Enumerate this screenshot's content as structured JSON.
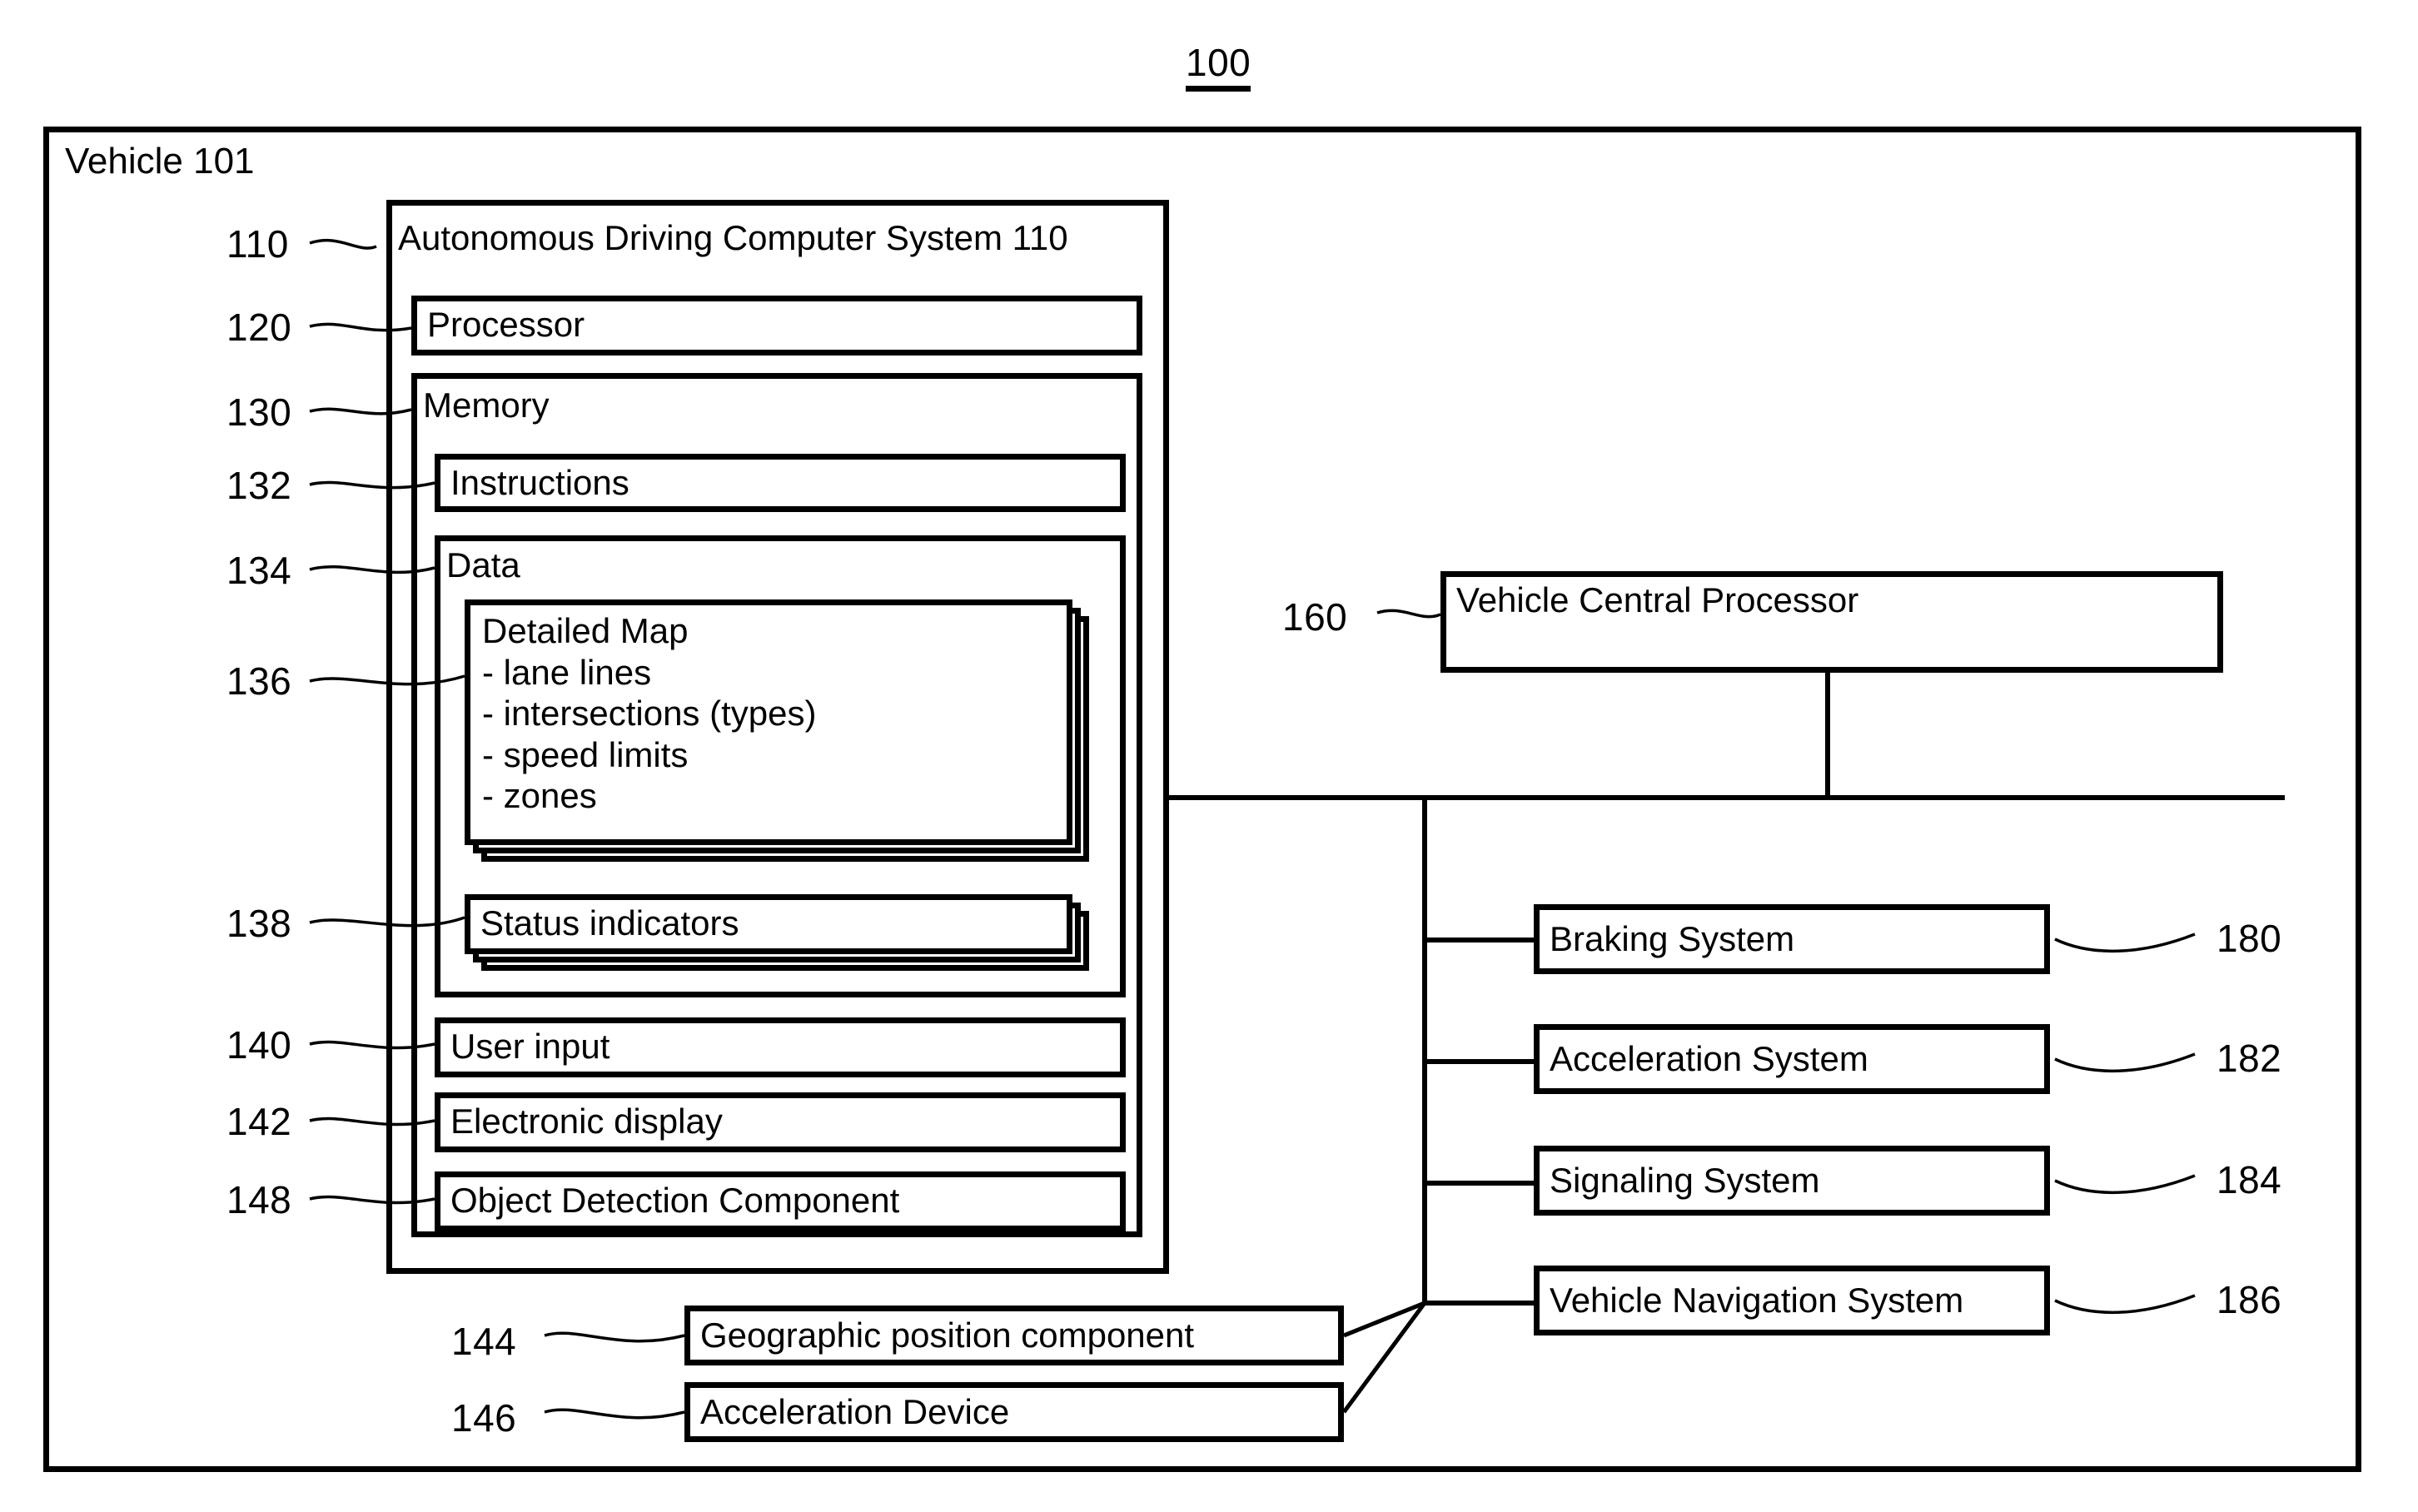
{
  "figure": {
    "number": "100"
  },
  "vehicle": {
    "label": "Vehicle 101"
  },
  "adcs": {
    "label": "Autonomous Driving Computer System 110",
    "ref": "110",
    "processor": {
      "label": "Processor",
      "ref": "120"
    },
    "memory": {
      "label": "Memory",
      "ref": "130",
      "instructions": {
        "label": "Instructions",
        "ref": "132"
      },
      "data": {
        "label": "Data",
        "ref": "134",
        "detailed_map": {
          "title": "Detailed Map",
          "ref": "136",
          "items": [
            "- lane lines",
            "- intersections (types)",
            "- speed limits",
            "- zones"
          ]
        },
        "status_indicators": {
          "label": "Status indicators",
          "ref": "138"
        }
      }
    },
    "user_input": {
      "label": "User input",
      "ref": "140"
    },
    "electronic_display": {
      "label": "Electronic display",
      "ref": "142"
    },
    "object_detection": {
      "label": "Object Detection Component",
      "ref": "148"
    }
  },
  "external_left": [
    {
      "label": "Geographic position component",
      "ref": "144"
    },
    {
      "label": "Acceleration Device",
      "ref": "146"
    }
  ],
  "central_processor": {
    "label": "Vehicle Central Processor",
    "ref": "160"
  },
  "subsystems": [
    {
      "label": "Braking System",
      "ref": "180"
    },
    {
      "label": "Acceleration System",
      "ref": "182"
    },
    {
      "label": "Signaling System",
      "ref": "184"
    },
    {
      "label": "Vehicle Navigation System",
      "ref": "186"
    }
  ],
  "colors": {
    "stroke": "#000000",
    "background": "#ffffff"
  }
}
